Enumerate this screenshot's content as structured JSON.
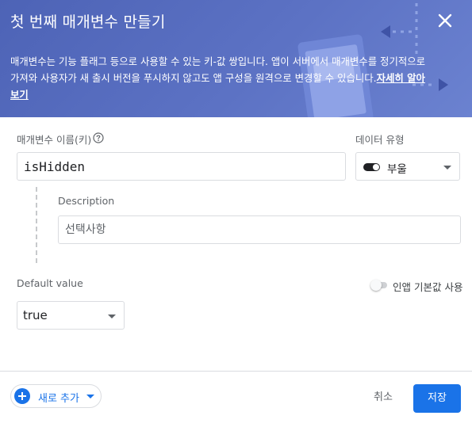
{
  "dialog": {
    "title": "첫 번째 매개변수 만들기",
    "description": "매개변수는 기능 플래그 등으로 사용할 수 있는 키-값 쌍입니다. 앱이 서버에서 매개변수를 정기적으로 가져와 사용자가 새 출시 버전을 푸시하지 않고도 앱 구성을 원격으로 변경할 수 있습니다.",
    "learn_more": "자세히 알아보기"
  },
  "form": {
    "param_name_label": "매개변수 이름(키)",
    "param_name_value": "isHidden",
    "data_type_label": "데이터 유형",
    "data_type_value": "부울",
    "description_label": "Description",
    "description_placeholder": "선택사항",
    "default_value_label": "Default value",
    "default_value": "true",
    "inapp_default_label": "인앱 기본값 사용"
  },
  "footer": {
    "add_new": "새로 추가",
    "cancel": "취소",
    "save": "저장"
  },
  "colors": {
    "header": "#5266b8",
    "accent": "#1a73e8"
  }
}
